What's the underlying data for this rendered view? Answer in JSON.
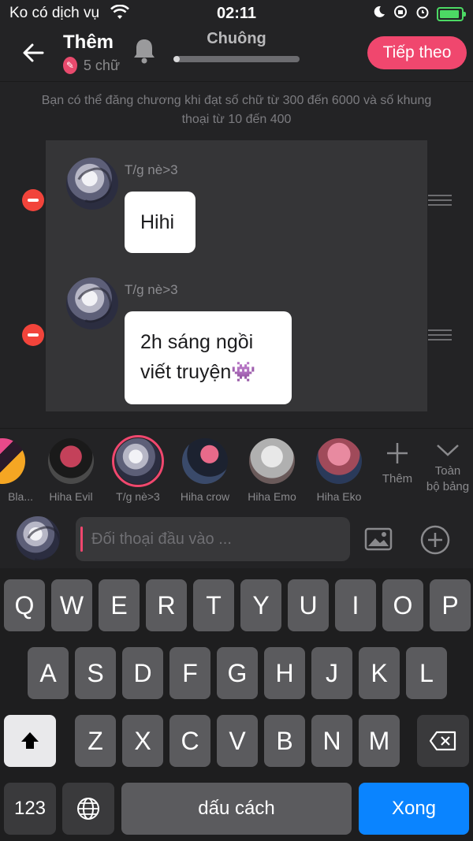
{
  "status_bar": {
    "carrier": "Ko có dịch vụ",
    "time": "02:11"
  },
  "header": {
    "title": "Thêm",
    "subtitle": "5 chữ",
    "progress_label": "Chuông",
    "progress_fraction": 0.05,
    "next_label": "Tiếp theo"
  },
  "hint": "Bạn có thể đăng chương khi đạt số chữ từ 300 đến 6000 và số khung thoại từ 10 đến 400",
  "dialogues": [
    {
      "speaker": "T/g nè>3",
      "text": "Hihi"
    },
    {
      "speaker": "T/g nè>3",
      "text_line1": "2h sáng ngồi",
      "text_line2": "viết truyện👾"
    }
  ],
  "characters": [
    {
      "name": "Bla...",
      "selected": false
    },
    {
      "name": "Hiha Evil",
      "selected": false
    },
    {
      "name": "T/g nè>3",
      "selected": true
    },
    {
      "name": "Hiha crow",
      "selected": false
    },
    {
      "name": "Hiha Emo",
      "selected": false
    },
    {
      "name": "Hiha Eko",
      "selected": false
    }
  ],
  "strip_actions": {
    "add_label": "Thêm",
    "all_line1": "Toàn",
    "all_line2": "bộ bảng"
  },
  "input": {
    "placeholder": "Đối thoại đầu vào ..."
  },
  "keyboard": {
    "row1": [
      "Q",
      "W",
      "E",
      "R",
      "T",
      "Y",
      "U",
      "I",
      "O",
      "P"
    ],
    "row2": [
      "A",
      "S",
      "D",
      "F",
      "G",
      "H",
      "J",
      "K",
      "L"
    ],
    "row3": [
      "Z",
      "X",
      "C",
      "V",
      "B",
      "N",
      "M"
    ],
    "numbers_key": "123",
    "space_key": "dấu cách",
    "done_key": "Xong"
  },
  "colors": {
    "accent": "#f0476e",
    "background": "#232325",
    "remove": "#f2443b",
    "done_key": "#0a84ff"
  }
}
